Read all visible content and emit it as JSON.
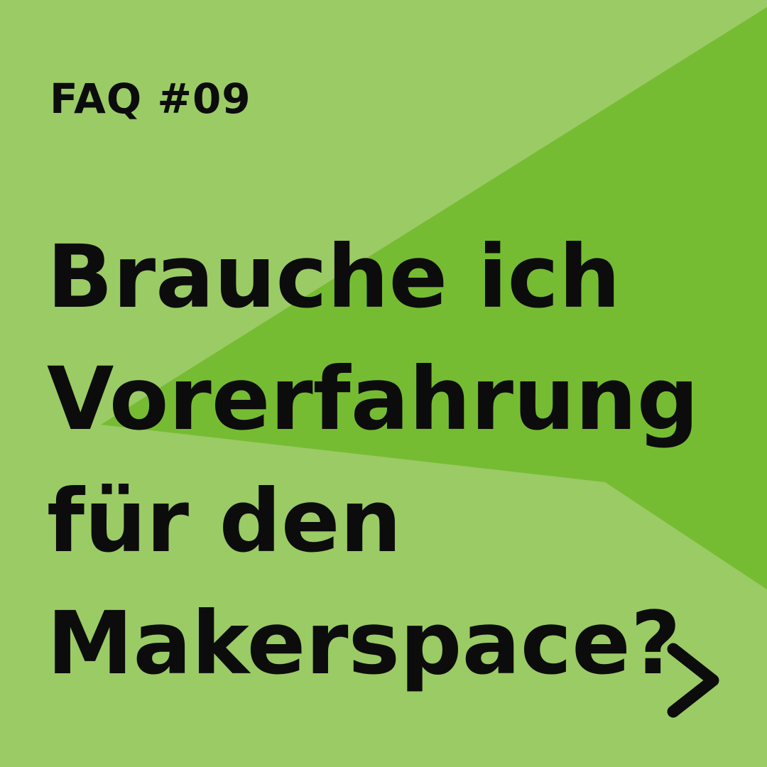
{
  "label": "FAQ #09",
  "headline": {
    "lines": [
      "Brauche ich",
      "Vorerfahrung",
      "für den",
      "Makerspace?"
    ]
  },
  "next_button": {
    "icon": "chevron-right-icon"
  },
  "colors": {
    "background_light_green": "#9bcb65",
    "shape_green": "#76bc33",
    "text": "#0c0c0c"
  }
}
